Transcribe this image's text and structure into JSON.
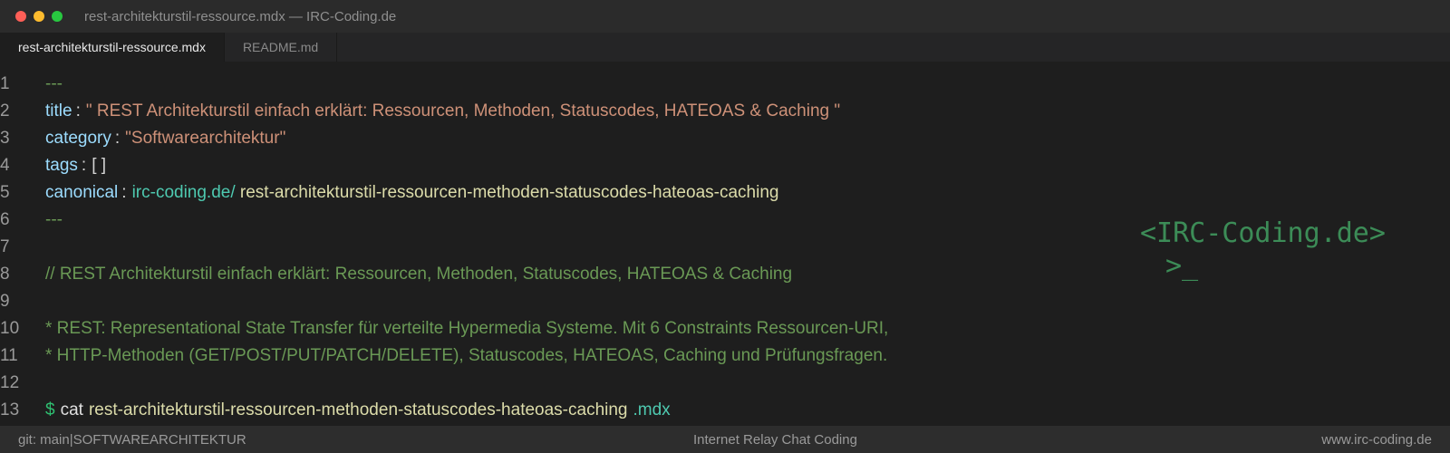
{
  "window": {
    "title": "rest-architekturstil-ressource.mdx — IRC-Coding.de",
    "traffic_lights": {
      "close": "#ff5f57",
      "minimize": "#febc2e",
      "maximize": "#28c840"
    }
  },
  "tabs": [
    {
      "label": "rest-architekturstil-ressource.mdx",
      "active": true
    },
    {
      "label": "README.md",
      "active": false
    }
  ],
  "editor": {
    "line_numbers": [
      "1",
      "2",
      "3",
      "4",
      "5",
      "6",
      "7",
      "8",
      "9",
      "10",
      "11",
      "12",
      "13"
    ],
    "frontmatter_delim": "---",
    "title_key": "title",
    "title_value": "\" REST Architekturstil einfach erklärt: Ressourcen, Methoden, Statuscodes, HATEOAS & Caching \"",
    "category_key": "category",
    "category_value": "\"Softwarearchitektur\"",
    "tags_key": "tags",
    "tags_value": "[ ]",
    "canonical_key": "canonical",
    "canonical_domain": "irc-coding.de/",
    "canonical_path": " rest-architekturstil-ressourcen-methoden-statuscodes-hateoas-caching",
    "colon": ":",
    "comment_line": "// REST Architekturstil einfach erklärt: Ressourcen, Methoden, Statuscodes, HATEOAS & Caching",
    "desc_line_1": "* REST: Representational State Transfer für verteilte Hypermedia Systeme. Mit 6 Constraints Ressourcen-URI,",
    "desc_line_2": "* HTTP-Methoden (GET/POST/PUT/PATCH/DELETE), Statuscodes, HATEOAS, Caching und Prüfungsfragen.",
    "prompt": "$",
    "command": "cat",
    "command_file": "rest-architekturstil-ressourcen-methoden-statuscodes-hateoas-caching",
    "command_ext": ".mdx"
  },
  "logo": {
    "text": "<IRC-Coding.de>",
    "cursor": ">_"
  },
  "statusbar": {
    "git_branch": "git: main",
    "separator": "|",
    "category": "SOFTWAREARCHITEKTUR",
    "center": "Internet Relay Chat Coding",
    "right": "www.irc-coding.de"
  }
}
